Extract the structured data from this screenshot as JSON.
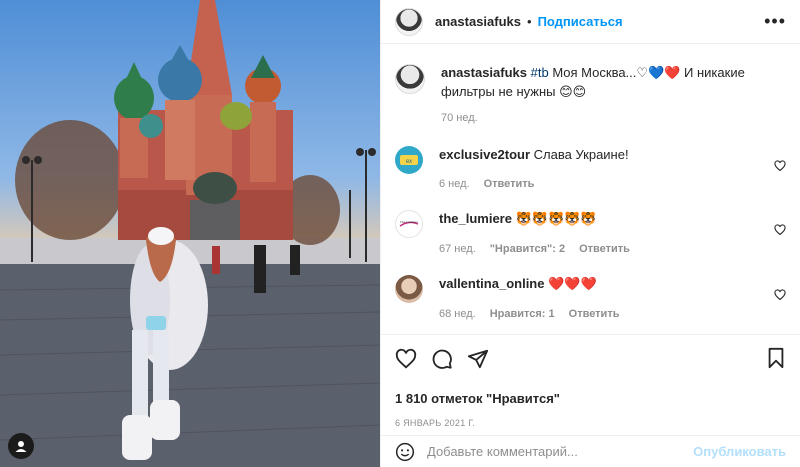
{
  "post": {
    "author": "anastasiafuks",
    "separator": "•",
    "follow_label": "Подписаться",
    "more_label": "•••"
  },
  "caption": {
    "username": "anastasiafuks",
    "hashtag": "#tb",
    "text_part1": " Моя Москва...",
    "hearts": "♡💙❤️",
    "text_part2": " И никакие фильтры не нужны ",
    "emoji_end": "😊😊",
    "time": "70 нед."
  },
  "comments": [
    {
      "username": "exclusive2tour",
      "text": "Слава Украине!",
      "time": "6 нед.",
      "likes": "",
      "reply_label": "Ответить"
    },
    {
      "username": "the_lumiere",
      "text": "🐯🐯🐯🐯🐯",
      "time": "67 нед.",
      "likes": "\"Нравится\": 2",
      "reply_label": "Ответить"
    },
    {
      "username": "vallentina_online",
      "text": "❤️❤️❤️",
      "time": "68 нед.",
      "likes": "Нравится: 1",
      "reply_label": "Ответить"
    }
  ],
  "likes_text": "1 810 отметок \"Нравится\"",
  "date_text": "6 ЯНВАРЬ 2021 Г.",
  "add_comment": {
    "placeholder": "Добавьте комментарий...",
    "publish_label": "Опубликовать"
  },
  "icons": {
    "like": "heart-icon",
    "comment": "comment-icon",
    "share": "share-icon",
    "save": "bookmark-icon",
    "emoji": "emoji-icon"
  },
  "colors": {
    "link": "#0095f6",
    "muted": "#8e8e8e",
    "publish_disabled": "#b2dffc"
  }
}
